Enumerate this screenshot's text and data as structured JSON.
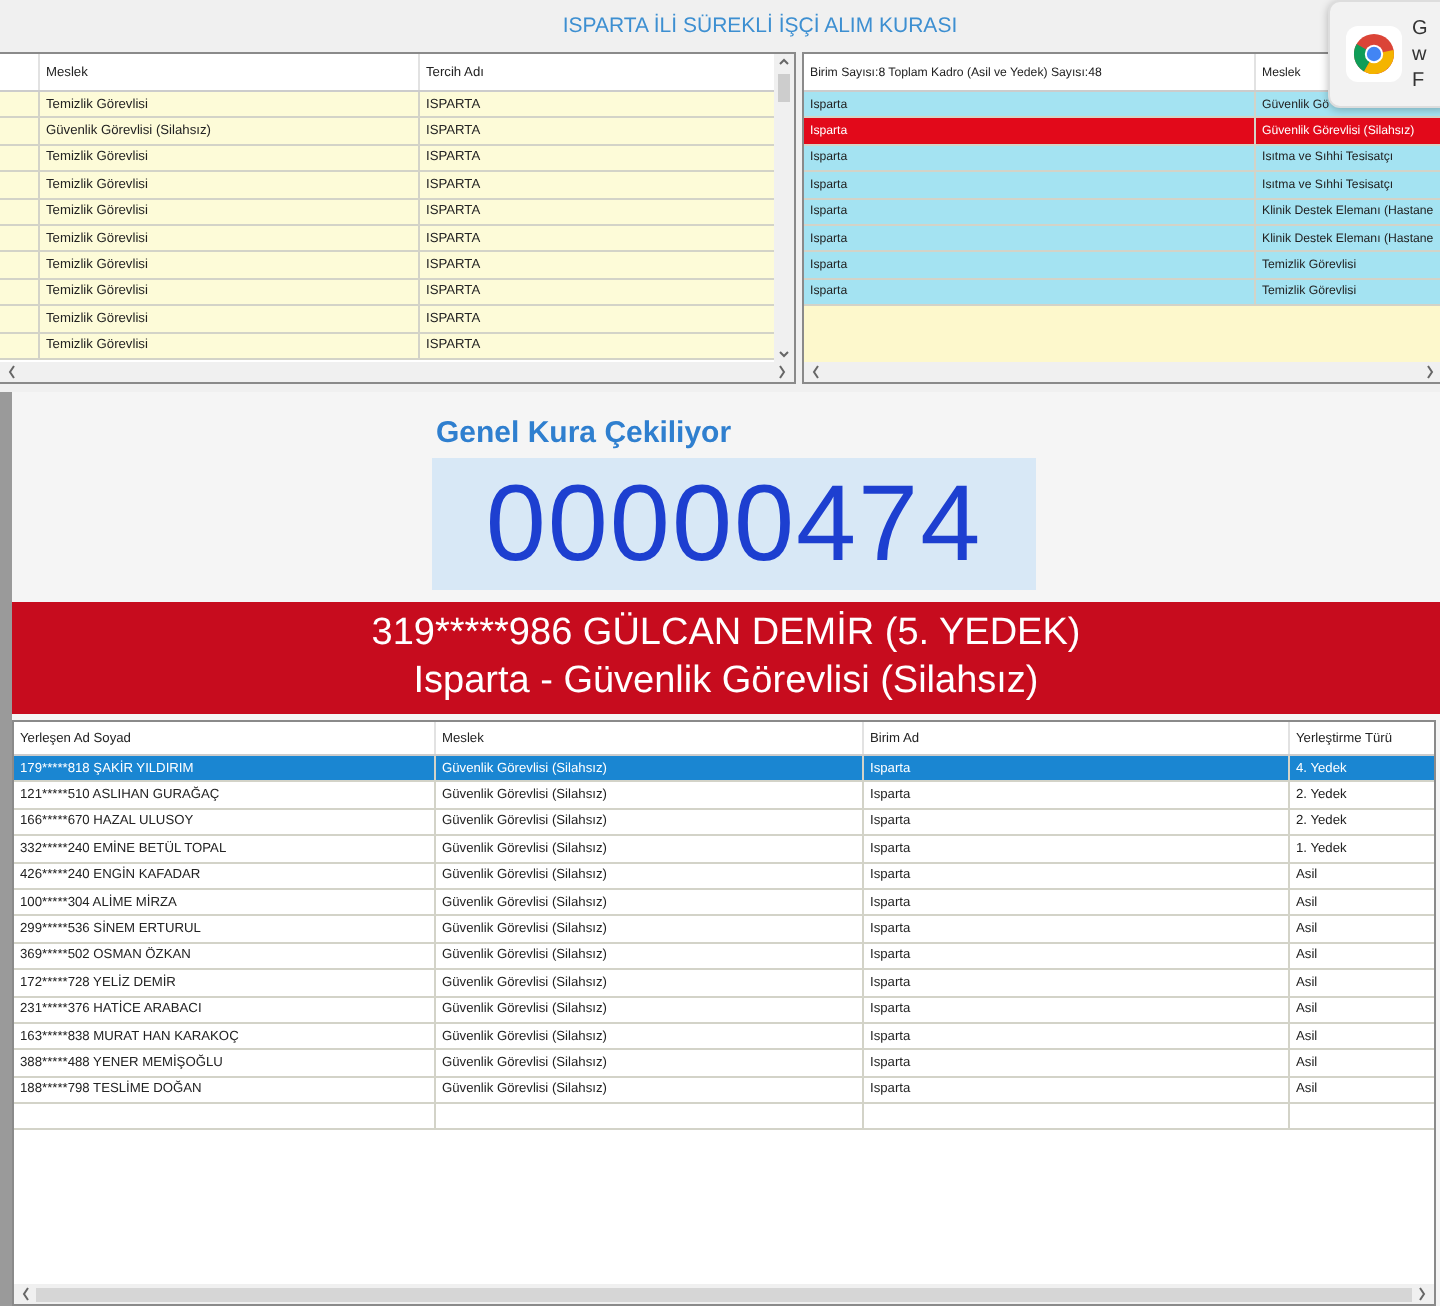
{
  "title": "ISPARTA İLİ SÜREKLİ İŞÇİ ALIM KURASI",
  "preferences_table": {
    "columns": [
      "Meslek",
      "Tercih Adı"
    ],
    "rows": [
      {
        "cells": [
          "Temizlik Görevlisi",
          "ISPARTA"
        ],
        "selected": false
      },
      {
        "cells": [
          "Güvenlik Görevlisi (Silahsız)",
          "ISPARTA"
        ],
        "selected": false
      },
      {
        "cells": [
          "Temizlik Görevlisi",
          "ISPARTA"
        ],
        "selected": false
      },
      {
        "cells": [
          "Temizlik Görevlisi",
          "ISPARTA"
        ],
        "selected": false
      },
      {
        "cells": [
          "Temizlik Görevlisi",
          "ISPARTA"
        ],
        "selected": false
      },
      {
        "cells": [
          "Temizlik Görevlisi",
          "ISPARTA"
        ],
        "selected": false
      },
      {
        "cells": [
          "Temizlik Görevlisi",
          "ISPARTA"
        ],
        "selected": false
      },
      {
        "cells": [
          "Temizlik Görevlisi",
          "ISPARTA"
        ],
        "selected": false
      },
      {
        "cells": [
          "Temizlik Görevlisi",
          "ISPARTA"
        ],
        "selected": false
      },
      {
        "cells": [
          "Temizlik Görevlisi",
          "ISPARTA"
        ],
        "selected": false
      }
    ]
  },
  "units_table": {
    "columns": [
      "Birim Sayısı:8 Toplam Kadro (Asil ve Yedek) Sayısı:48",
      "Meslek"
    ],
    "rows": [
      {
        "cells": [
          "Isparta",
          "Güvenlik Gö"
        ],
        "selected": false
      },
      {
        "cells": [
          "Isparta",
          "Güvenlik Görevlisi (Silahsız)"
        ],
        "selected": true
      },
      {
        "cells": [
          "Isparta",
          "Isıtma ve Sıhhi Tesisatçı"
        ],
        "selected": false
      },
      {
        "cells": [
          "Isparta",
          "Isıtma ve Sıhhi Tesisatçı"
        ],
        "selected": false
      },
      {
        "cells": [
          "Isparta",
          "Klinik Destek Elemanı (Hastane"
        ],
        "selected": false
      },
      {
        "cells": [
          "Isparta",
          "Klinik Destek Elemanı (Hastane"
        ],
        "selected": false
      },
      {
        "cells": [
          "Isparta",
          "Temizlik Görevlisi"
        ],
        "selected": false
      },
      {
        "cells": [
          "Isparta",
          "Temizlik Görevlisi"
        ],
        "selected": false
      }
    ]
  },
  "notification": {
    "lines": [
      "G",
      "w",
      "F"
    ]
  },
  "draw": {
    "heading": "Genel Kura Çekiliyor",
    "number": "00000474"
  },
  "result": {
    "line_1": "319*****986 GÜLCAN DEMİR (5. YEDEK)",
    "line_2": "Isparta - Güvenlik Görevlisi (Silahsız)"
  },
  "placements_table": {
    "columns": [
      "Yerleşen Ad Soyad",
      "Meslek",
      "Birim Ad",
      "Yerleştirme Türü"
    ],
    "rows": [
      {
        "cells": [
          "179*****818 ŞAKİR YILDIRIM",
          "Güvenlik Görevlisi (Silahsız)",
          "Isparta",
          "4. Yedek"
        ],
        "selected": true
      },
      {
        "cells": [
          "121*****510 ASLIHAN GURAĞAÇ",
          "Güvenlik Görevlisi (Silahsız)",
          "Isparta",
          "2. Yedek"
        ],
        "selected": false
      },
      {
        "cells": [
          "166*****670 HAZAL ULUSOY",
          "Güvenlik Görevlisi (Silahsız)",
          "Isparta",
          "2. Yedek"
        ],
        "selected": false
      },
      {
        "cells": [
          "332*****240 EMİNE BETÜL TOPAL",
          "Güvenlik Görevlisi (Silahsız)",
          "Isparta",
          "1. Yedek"
        ],
        "selected": false
      },
      {
        "cells": [
          "426*****240 ENGİN KAFADAR",
          "Güvenlik Görevlisi (Silahsız)",
          "Isparta",
          "Asil"
        ],
        "selected": false
      },
      {
        "cells": [
          "100*****304 ALİME MİRZA",
          "Güvenlik Görevlisi (Silahsız)",
          "Isparta",
          "Asil"
        ],
        "selected": false
      },
      {
        "cells": [
          "299*****536 SİNEM ERTURUL",
          "Güvenlik Görevlisi (Silahsız)",
          "Isparta",
          "Asil"
        ],
        "selected": false
      },
      {
        "cells": [
          "369*****502 OSMAN ÖZKAN",
          "Güvenlik Görevlisi (Silahsız)",
          "Isparta",
          "Asil"
        ],
        "selected": false
      },
      {
        "cells": [
          "172*****728 YELİZ DEMİR",
          "Güvenlik Görevlisi (Silahsız)",
          "Isparta",
          "Asil"
        ],
        "selected": false
      },
      {
        "cells": [
          "231*****376 HATİCE ARABACI",
          "Güvenlik Görevlisi (Silahsız)",
          "Isparta",
          "Asil"
        ],
        "selected": false
      },
      {
        "cells": [
          "163*****838 MURAT HAN KARAKOÇ",
          "Güvenlik Görevlisi (Silahsız)",
          "Isparta",
          "Asil"
        ],
        "selected": false
      },
      {
        "cells": [
          "388*****488 YENER MEMİŞOĞLU",
          "Güvenlik Görevlisi (Silahsız)",
          "Isparta",
          "Asil"
        ],
        "selected": false
      },
      {
        "cells": [
          "188*****798 TESLİME DOĞAN",
          "Güvenlik Görevlisi (Silahsız)",
          "Isparta",
          "Asil"
        ],
        "selected": false
      }
    ]
  }
}
